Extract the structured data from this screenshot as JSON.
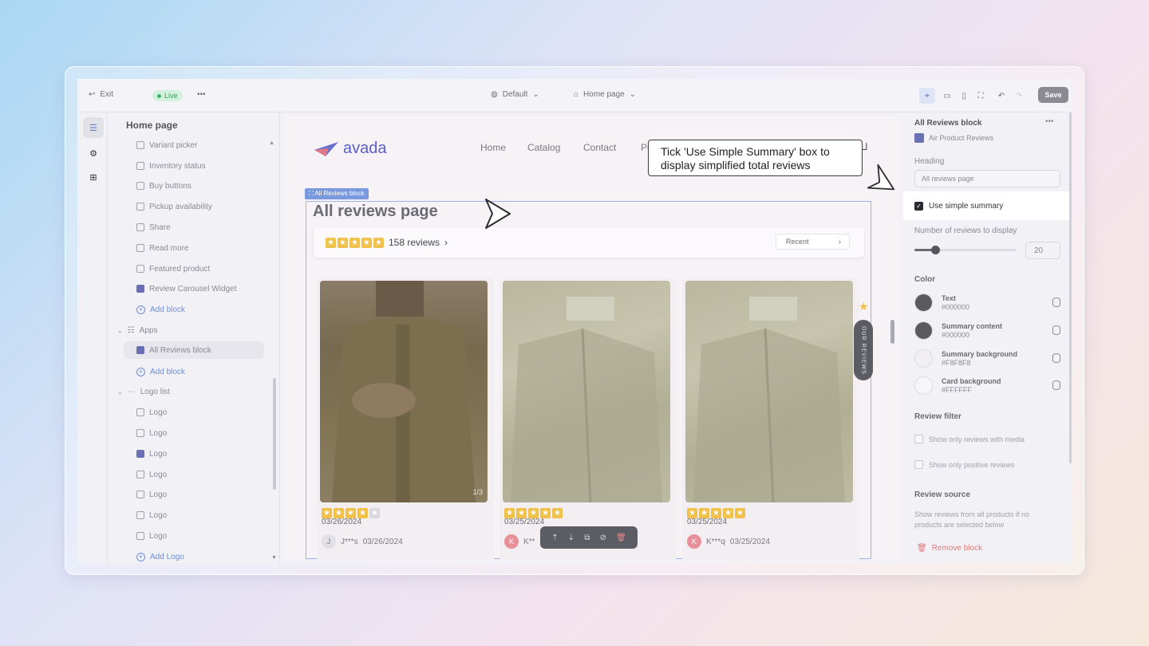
{
  "topbar": {
    "exit_label": "Exit",
    "live_label": "Live",
    "more_label": "•••",
    "theme_label": "Default",
    "page_label": "Home page",
    "save_label": "Save"
  },
  "left_panel": {
    "title": "Home page",
    "items": [
      {
        "label": "Variant picker"
      },
      {
        "label": "Inventory status"
      },
      {
        "label": "Buy buttons"
      },
      {
        "label": "Pickup availability"
      },
      {
        "label": "Share"
      },
      {
        "label": "Read more"
      },
      {
        "label": "Featured product"
      },
      {
        "label": "Review Carousel Widget"
      }
    ],
    "add_block_1": "Add block",
    "apps_label": "Apps",
    "app_item": "All Reviews block",
    "add_block_2": "Add block",
    "logo_list_label": "Logo list",
    "logos": [
      "Logo",
      "Logo",
      "Logo",
      "Logo",
      "Logo",
      "Logo",
      "Logo"
    ],
    "add_logo": "Add Logo"
  },
  "preview": {
    "brand": "avada",
    "nav": [
      "Home",
      "Catalog",
      "Contact",
      "Pr"
    ],
    "block_tag": "All Reviews block",
    "heading": "All reviews page",
    "summary_count": "158 reviews",
    "sort_label": "Recent",
    "side_tab": "OUR REVIEWS",
    "cards": [
      {
        "rating": 4,
        "date": "03/26/2024",
        "initial": "J",
        "author": "J***s",
        "author_date": "03/26/2024",
        "counter": "1/3"
      },
      {
        "rating": 5,
        "date": "03/25/2024",
        "initial": "K",
        "author": "K**",
        "author_date": ""
      },
      {
        "rating": 5,
        "date": "03/25/2024",
        "initial": "K",
        "author": "K***q",
        "author_date": "03/25/2024"
      }
    ]
  },
  "tooltip": {
    "text": "Tick 'Use Simple Summary' box to display simplified total reviews"
  },
  "right_panel": {
    "title": "All Reviews block",
    "app_name": "Air Product Reviews",
    "heading_label": "Heading",
    "heading_value": "All reviews page",
    "simple_summary_label": "Use simple summary",
    "simple_summary_checked": true,
    "num_reviews_label": "Number of reviews to display",
    "num_reviews_value": "20",
    "num_reviews_fraction": 0.2,
    "color_label": "Color",
    "colors": [
      {
        "name": "Text",
        "hex": "#000000",
        "swatch": "#5a5a5f"
      },
      {
        "name": "Summary content",
        "hex": "#000000",
        "swatch": "#5a5a5f"
      },
      {
        "name": "Summary background",
        "hex": "#F8F8F8",
        "swatch": "#f1eff3"
      },
      {
        "name": "Card background",
        "hex": "#FFFFFF",
        "swatch": "#f6f5f8"
      }
    ],
    "review_filter_label": "Review filter",
    "filter_media": "Show only reviews with media",
    "filter_positive": "Show only positive reviews",
    "review_source_label": "Review source",
    "review_source_desc": "Show reviews from all products if no products are selected below",
    "remove_label": "Remove block"
  }
}
